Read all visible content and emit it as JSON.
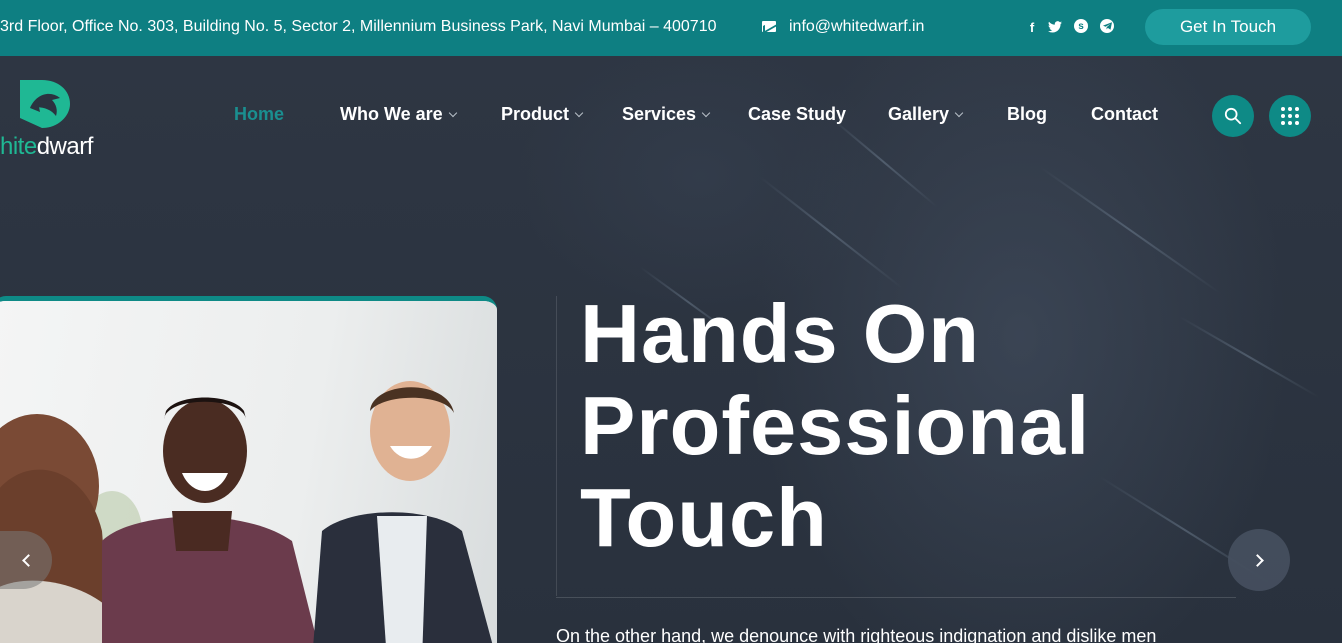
{
  "topbar": {
    "address": "3rd Floor, Office No. 303, Building No. 5, Sector 2, Millennium Business Park, Navi Mumbai – 400710",
    "email": "info@whitedwarf.in",
    "social_icons": [
      "facebook-icon",
      "twitter-icon",
      "skype-icon",
      "telegram-icon"
    ],
    "cta_label": "Get In Touch"
  },
  "logo": {
    "word_part1": "hite",
    "word_part2": "dwarf"
  },
  "nav": {
    "items": [
      {
        "label": "Home",
        "active": true,
        "dropdown": false
      },
      {
        "label": "Who We are",
        "active": false,
        "dropdown": true
      },
      {
        "label": "Product",
        "active": false,
        "dropdown": true
      },
      {
        "label": "Services",
        "active": false,
        "dropdown": true
      },
      {
        "label": "Case Study",
        "active": false,
        "dropdown": false
      },
      {
        "label": "Gallery",
        "active": false,
        "dropdown": true
      },
      {
        "label": "Blog",
        "active": false,
        "dropdown": false
      },
      {
        "label": "Contact",
        "active": false,
        "dropdown": false
      }
    ]
  },
  "hero": {
    "headline": [
      "Hands On",
      "Professional",
      "Touch"
    ],
    "paragraph": "On the other hand, we denounce with righteous indignation and dislike men"
  },
  "colors": {
    "accent": "#0e8a86",
    "topbar": "#0e7f82",
    "background": "#2b3340",
    "logo_green": "#1fb894"
  }
}
